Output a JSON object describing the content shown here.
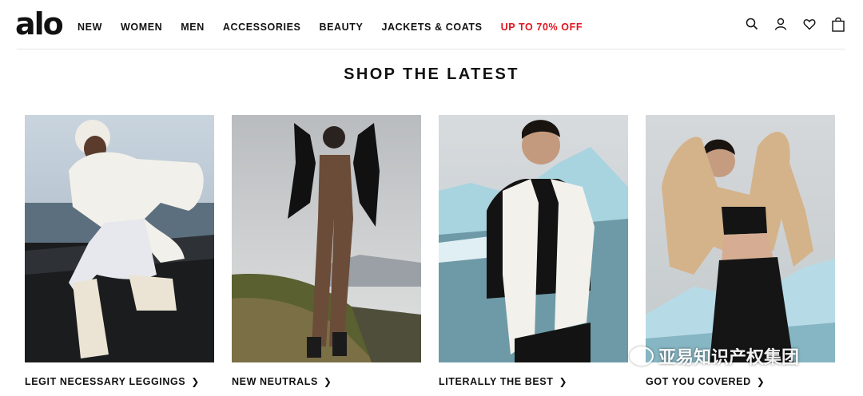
{
  "header": {
    "logo": "alo",
    "nav": [
      {
        "label": "NEW",
        "name": "nav-new"
      },
      {
        "label": "WOMEN",
        "name": "nav-women"
      },
      {
        "label": "MEN",
        "name": "nav-men"
      },
      {
        "label": "ACCESSORIES",
        "name": "nav-accessories"
      },
      {
        "label": "BEAUTY",
        "name": "nav-beauty"
      },
      {
        "label": "JACKETS & COATS",
        "name": "nav-jackets-coats"
      },
      {
        "label": "UP TO 70% OFF",
        "name": "nav-sale"
      }
    ],
    "icons": [
      "search-icon",
      "account-icon",
      "wishlist-heart-icon",
      "shopping-bag-icon"
    ]
  },
  "section": {
    "title": "SHOP THE LATEST"
  },
  "cards": [
    {
      "caption": "LEGIT NECESSARY LEGGINGS",
      "image": "woman in white puffer jacket and white leggings crouching on black sand beach"
    },
    {
      "caption": "NEW NEUTRALS",
      "image": "woman in brown jumpsuit and black fur jacket on mountain cliff"
    },
    {
      "caption": "LITERALLY THE BEST",
      "image": "woman in white puffer vest with icebergs behind"
    },
    {
      "caption": "GOT YOU COVERED",
      "image": "woman in tan teddy jacket and black set near icebergs"
    }
  ],
  "watermark": "亚易知识产权集团",
  "colors": {
    "sale": "#e0141e",
    "text": "#111111"
  }
}
